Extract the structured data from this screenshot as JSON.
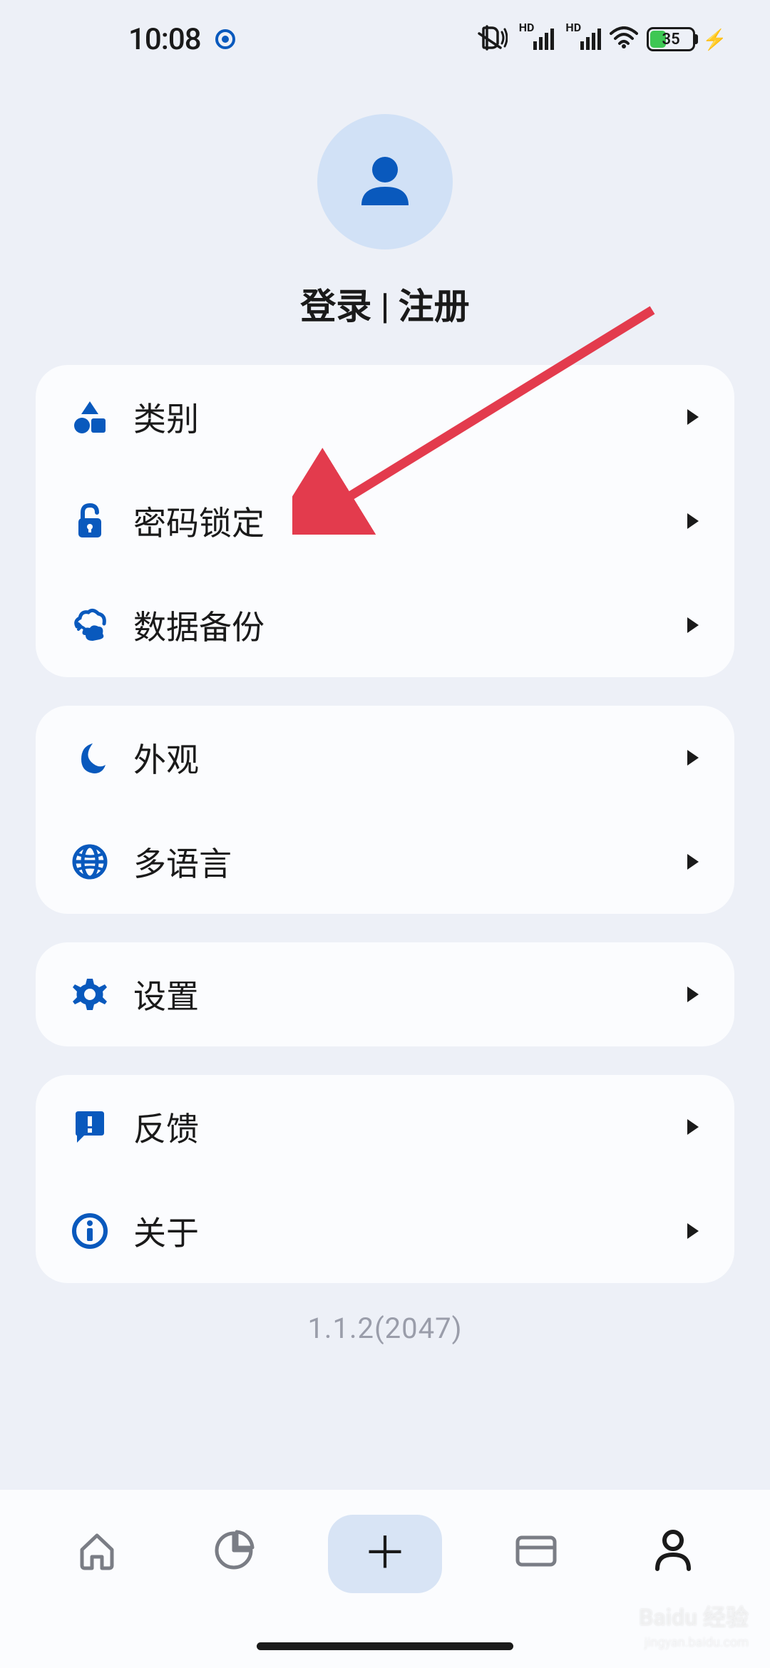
{
  "status_bar": {
    "time": "10:08",
    "battery_percent": "35",
    "hd_label": "HD"
  },
  "profile": {
    "login_register": "登录 | 注册"
  },
  "settings": {
    "group1": [
      {
        "label": "类别",
        "icon": "category"
      },
      {
        "label": "密码锁定",
        "icon": "lock"
      },
      {
        "label": "数据备份",
        "icon": "backup"
      }
    ],
    "group2": [
      {
        "label": "外观",
        "icon": "moon"
      },
      {
        "label": "多语言",
        "icon": "globe"
      }
    ],
    "group3": [
      {
        "label": "设置",
        "icon": "gear"
      }
    ],
    "group4": [
      {
        "label": "反馈",
        "icon": "feedback"
      },
      {
        "label": "关于",
        "icon": "info"
      }
    ]
  },
  "version": "1.1.2(2047)",
  "watermark": {
    "main": "Baidu 经验",
    "sub": "jingyan.baidu.com"
  },
  "colors": {
    "accent": "#0959bd",
    "background": "#edf0f7",
    "card": "#fbfcfe",
    "avatar_bg": "#d1e1f6",
    "arrow": "#e33b4d"
  }
}
